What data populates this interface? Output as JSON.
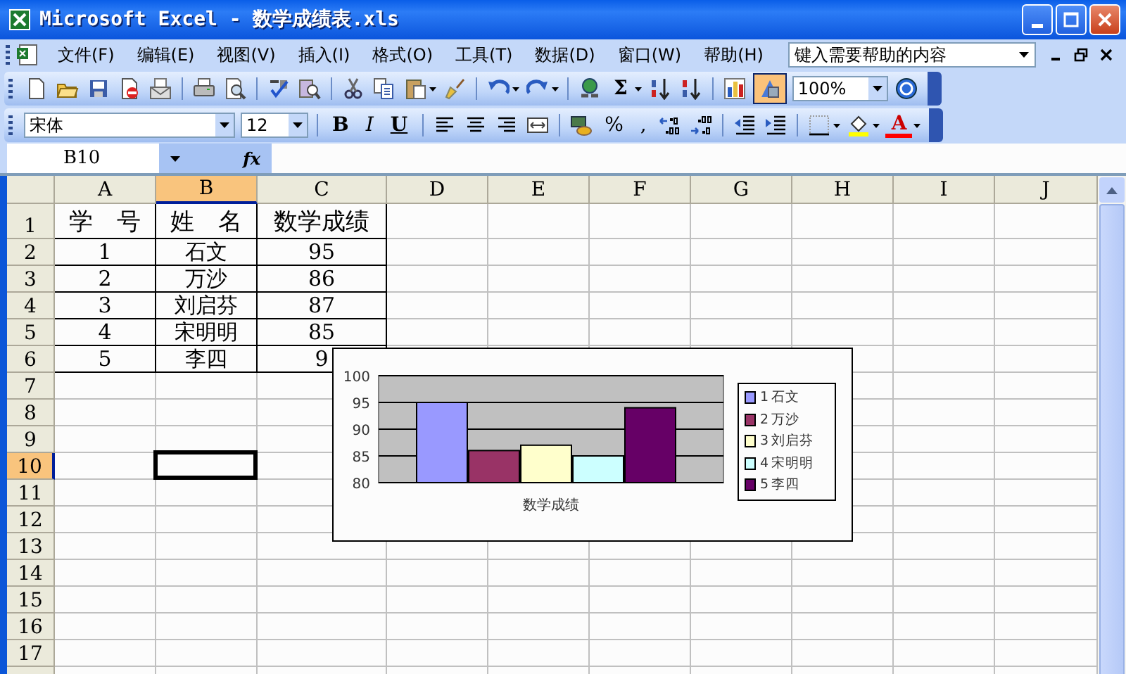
{
  "window": {
    "title": "Microsoft Excel - 数学成绩表.xls"
  },
  "menu": [
    "文件(F)",
    "编辑(E)",
    "视图(V)",
    "插入(I)",
    "格式(O)",
    "工具(T)",
    "数据(D)",
    "窗口(W)",
    "帮助(H)"
  ],
  "help_search": {
    "placeholder": "键入需要帮助的内容"
  },
  "standard_toolbar": {
    "autosum_glyph": "Σ",
    "drawing_on": true,
    "zoom": "100%"
  },
  "formatting_toolbar": {
    "font": "宋体",
    "size": "12",
    "style_buttons": [
      "B",
      "I",
      "U"
    ],
    "number_buttons": [
      "%",
      ","
    ],
    "font_color_glyph": "A"
  },
  "formula_bar": {
    "name_box": "B10",
    "fx_label": "fx"
  },
  "sheet": {
    "columns": [
      {
        "label": "A",
        "selected": false
      },
      {
        "label": "B",
        "selected": true
      },
      {
        "label": "C",
        "selected": false
      },
      {
        "label": "D",
        "selected": false
      },
      {
        "label": "E",
        "selected": false
      },
      {
        "label": "F",
        "selected": false
      },
      {
        "label": "G",
        "selected": false
      },
      {
        "label": "H",
        "selected": false
      },
      {
        "label": "I",
        "selected": false
      },
      {
        "label": "J",
        "selected": false
      }
    ],
    "rows": [
      {
        "label": "1",
        "selected": false,
        "cells": [
          "学　号",
          "姓　名",
          "数学成绩"
        ]
      },
      {
        "label": "2",
        "selected": false,
        "cells": [
          "1",
          "石文",
          "95"
        ]
      },
      {
        "label": "3",
        "selected": false,
        "cells": [
          "2",
          "万沙",
          "86"
        ]
      },
      {
        "label": "4",
        "selected": false,
        "cells": [
          "3",
          "刘启芬",
          "87"
        ]
      },
      {
        "label": "5",
        "selected": false,
        "cells": [
          "4",
          "宋明明",
          "85"
        ]
      },
      {
        "label": "6",
        "selected": false,
        "cells": [
          "5",
          "李四",
          "9"
        ]
      },
      {
        "label": "7",
        "selected": false
      },
      {
        "label": "8",
        "selected": false
      },
      {
        "label": "9",
        "selected": false
      },
      {
        "label": "10",
        "selected": true
      },
      {
        "label": "11",
        "selected": false
      },
      {
        "label": "12",
        "selected": false
      },
      {
        "label": "13",
        "selected": false
      },
      {
        "label": "14",
        "selected": false
      },
      {
        "label": "15",
        "selected": false
      },
      {
        "label": "16",
        "selected": false
      },
      {
        "label": "17",
        "selected": false
      }
    ],
    "chart_data": {
      "type": "bar",
      "grid": true,
      "legend": true,
      "categories": [
        "数学成绩"
      ],
      "ylim": [
        80,
        100
      ],
      "yticks": [
        80,
        85,
        90,
        95,
        100
      ],
      "series": [
        {
          "name": "1 石文",
          "color": "#9999ff",
          "values": [
            95
          ]
        },
        {
          "name": "2 万沙",
          "color": "#993366",
          "values": [
            86
          ]
        },
        {
          "name": "3 刘启芬",
          "color": "#ffffcc",
          "values": [
            87
          ]
        },
        {
          "name": "4 宋明明",
          "color": "#ccffff",
          "values": [
            85
          ]
        },
        {
          "name": "5 李四",
          "color": "#660066",
          "values": [
            94
          ]
        }
      ]
    }
  }
}
